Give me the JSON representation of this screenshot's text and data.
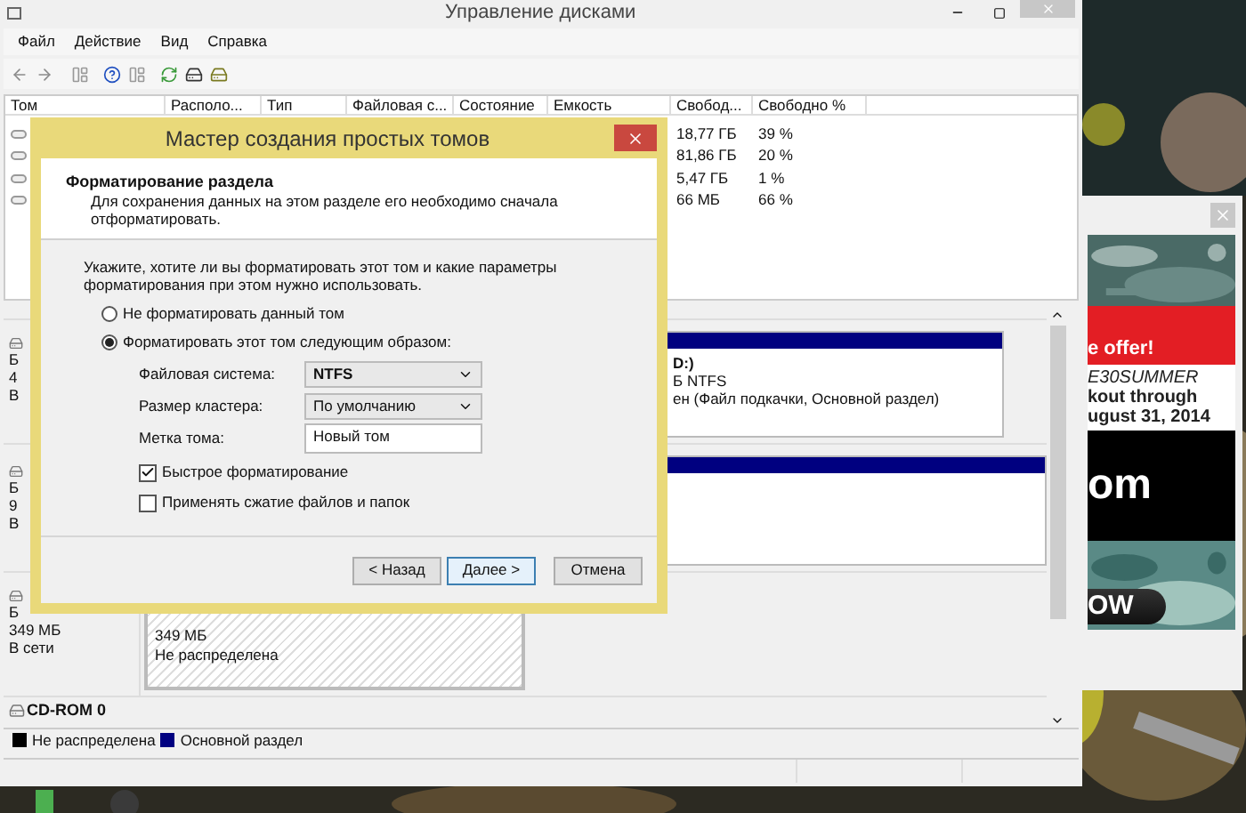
{
  "window": {
    "title": "Управление дисками"
  },
  "menu": [
    "Файл",
    "Действие",
    "Вид",
    "Справка"
  ],
  "volume_table": {
    "columns": [
      "Том",
      "Располо...",
      "Тип",
      "Файловая с...",
      "Состояние",
      "Емкость",
      "Свобод...",
      "Свободно %"
    ],
    "rows": [
      {
        "free": "18,77 ГБ",
        "free_pct": "39 %"
      },
      {
        "free": "81,86 ГБ",
        "free_pct": "20 %"
      },
      {
        "free": "5,47 ГБ",
        "free_pct": "1 %"
      },
      {
        "free": "66 МБ",
        "free_pct": "66 %"
      }
    ]
  },
  "disks": [
    {
      "kind": "disk",
      "label": [
        "Б",
        "4",
        "В"
      ],
      "partition": {
        "kind": "primary",
        "lines": [
          "D:)",
          "Б NTFS",
          "ен (Файл подкачки, Основной раздел)"
        ]
      }
    },
    {
      "kind": "disk",
      "label": [
        "Б",
        "9",
        "В"
      ],
      "partition": {
        "kind": "primary"
      }
    },
    {
      "kind": "disk",
      "label": [
        "Б",
        "349 МБ",
        "В сети"
      ],
      "partition": {
        "kind": "unallocated",
        "lines": [
          "349 МБ",
          "Не распределена"
        ]
      }
    },
    {
      "kind": "cdrom",
      "label": [
        "CD-ROM 0"
      ]
    }
  ],
  "legend": [
    {
      "label": "Не распределена",
      "color": "#000000"
    },
    {
      "label": "Основной раздел",
      "color": "#000080"
    }
  ],
  "dialog": {
    "title": "Мастер создания простых томов",
    "heading": "Форматирование раздела",
    "subtitle": "Для сохранения данных на этом разделе его необходимо сначала отформатировать.",
    "instruction": "Укажите, хотите ли вы форматировать этот том и какие параметры форматирования при этом нужно использовать.",
    "options": [
      {
        "label": "Не форматировать данный том",
        "selected": false
      },
      {
        "label": "Форматировать этот том следующим образом:",
        "selected": true
      }
    ],
    "fields": [
      {
        "kind": "select",
        "label": "Файловая система:",
        "value": "NTFS"
      },
      {
        "kind": "select",
        "label": "Размер кластера:",
        "value": "По умолчанию"
      },
      {
        "kind": "text",
        "label": "Метка тома:",
        "value": "Новый том"
      }
    ],
    "checkboxes": [
      {
        "label": "Быстрое форматирование",
        "checked": true
      },
      {
        "label": "Применять сжатие файлов и папок",
        "checked": false
      }
    ],
    "buttons": [
      {
        "label": "< Назад",
        "highlighted": false
      },
      {
        "label": "Далее >",
        "highlighted": true
      },
      {
        "label": "Отмена",
        "highlighted": false
      }
    ]
  },
  "ad": {
    "headline": "e offer!",
    "code": "E30SUMMER",
    "lines": [
      "kout through",
      "ugust 31, 2014"
    ],
    "brand": "om",
    "button": "OW"
  }
}
